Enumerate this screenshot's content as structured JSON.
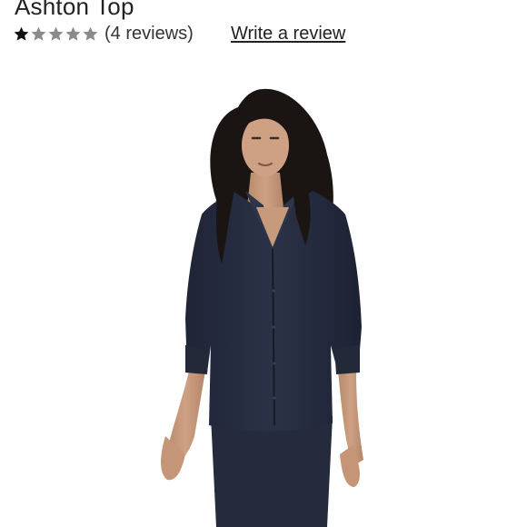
{
  "product": {
    "title": "Ashton Top",
    "rating": 1,
    "rating_max": 5,
    "reviews_label": "(4 reviews)",
    "write_review_label": "Write a review"
  },
  "colors": {
    "star_filled": "#111111",
    "star_empty": "#8a8a8a",
    "top_color": "#262c40",
    "jeans_color": "#252a3d",
    "hair_color": "#1a1412",
    "skin_color": "#c79a7c"
  },
  "image": {
    "icon": "product-photo"
  }
}
